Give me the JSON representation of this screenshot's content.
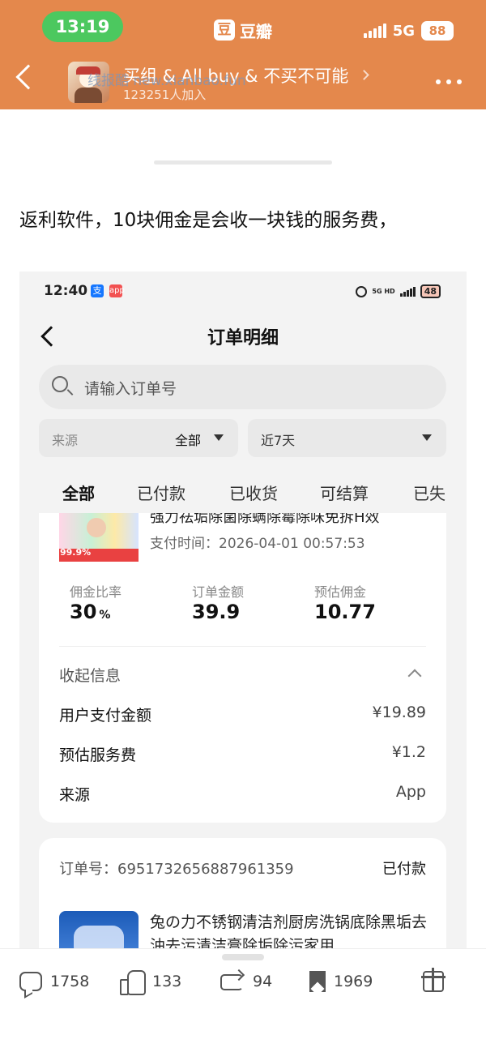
{
  "status_bar": {
    "time": "13:19",
    "network": "5G",
    "battery": "88"
  },
  "app": {
    "logo_char": "豆",
    "name": "豆瓣"
  },
  "group_header": {
    "title": "买组 & All buy & 不买不可能",
    "members": "123251人加入",
    "watermark": "线报酷 new.xianbao.fun"
  },
  "post": {
    "text": "返利软件，10块佣金是会收一块钱的服务费，"
  },
  "screenshot": {
    "status_bar": {
      "time": "12:40",
      "net": "5G HD",
      "battery": "48"
    },
    "title": "订单明细",
    "search_placeholder": "请输入订单号",
    "filters": {
      "source_label": "来源",
      "source_value": "全部",
      "period_value": "近7天"
    },
    "tabs": [
      "全部",
      "已付款",
      "已收货",
      "可结算",
      "已失"
    ],
    "order1": {
      "product_name": "强力祛垢除菌除螨除霉除味免拆H效",
      "thumb_badge": "99.9%",
      "pay_time": "支付时间：2026-04-01 00:57:53",
      "stats": [
        {
          "label": "佣金比率",
          "value": "30",
          "unit": "%"
        },
        {
          "label": "订单金额",
          "value": "39.9",
          "unit": ""
        },
        {
          "label": "预估佣金",
          "value": "10.77",
          "unit": ""
        }
      ],
      "collapse_label": "收起信息",
      "rows": [
        {
          "label": "用户支付金额",
          "value": "¥19.89"
        },
        {
          "label": "预估服务费",
          "value": "¥1.2"
        },
        {
          "label": "来源",
          "value": "App"
        }
      ]
    },
    "order2": {
      "order_no": "订单号：6951732656887961359",
      "status": "已付款",
      "product_name": "兔の力不锈钢清洁剂厨房洗锅底除黑垢去油去污清洁膏除垢除污家用"
    }
  },
  "actions": {
    "comments": "1758",
    "likes": "133",
    "reposts": "94",
    "collects": "1969"
  }
}
